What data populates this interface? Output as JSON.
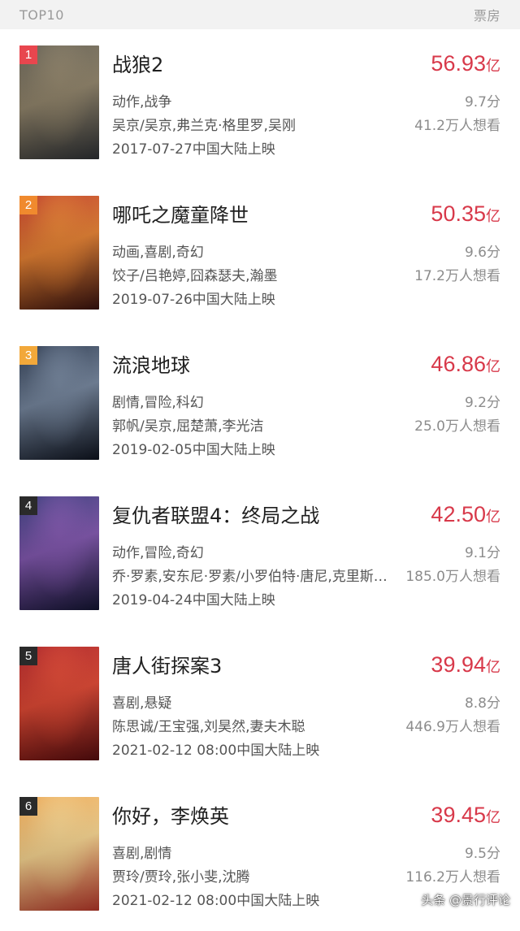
{
  "header": {
    "left": "TOP10",
    "right": "票房"
  },
  "movies": [
    {
      "rank": "1",
      "rank_color": "#e8464e",
      "title": "战狼2",
      "box_num": "56.93",
      "box_unit": "亿",
      "genre": "动作,战争",
      "score": "9.7分",
      "cast": "吴京/吴京,弗兰克·格里罗,吴刚",
      "want": "41.2万人想看",
      "release": "2017-07-27中国大陆上映",
      "poster_colors": [
        "#5a5548",
        "#8a7d63",
        "#2f3236"
      ]
    },
    {
      "rank": "2",
      "rank_color": "#f08a2e",
      "title": "哪吒之魔童降世",
      "box_num": "50.35",
      "box_unit": "亿",
      "genre": "动画,喜剧,奇幻",
      "score": "9.6分",
      "cast": "饺子/吕艳婷,囧森瑟夫,瀚墨",
      "want": "17.2万人想看",
      "release": "2019-07-26中国大陆上映",
      "poster_colors": [
        "#b8321e",
        "#e07a2a",
        "#3a1210"
      ]
    },
    {
      "rank": "3",
      "rank_color": "#f2a83a",
      "title": "流浪地球",
      "box_num": "46.86",
      "box_unit": "亿",
      "genre": "剧情,冒险,科幻",
      "score": "9.2分",
      "cast": "郭帆/吴京,屈楚萧,李光洁",
      "want": "25.0万人想看",
      "release": "2019-02-05中国大陆上映",
      "poster_colors": [
        "#1d2a40",
        "#6d7e96",
        "#0f1420"
      ]
    },
    {
      "rank": "4",
      "rank_color": "#2a2a2a",
      "title": "复仇者联盟4：终局之战",
      "box_num": "42.50",
      "box_unit": "亿",
      "genre": "动作,冒险,奇幻",
      "score": "9.1分",
      "cast": "乔·罗素,安东尼·罗素/小罗伯特·唐尼,克里斯…",
      "want": "185.0万人想看",
      "release": "2019-04-24中国大陆上映",
      "poster_colors": [
        "#2a2f6e",
        "#7a4fa8",
        "#131533"
      ]
    },
    {
      "rank": "5",
      "rank_color": "#2a2a2a",
      "title": "唐人街探案3",
      "box_num": "39.94",
      "box_unit": "亿",
      "genre": "喜剧,悬疑",
      "score": "8.8分",
      "cast": "陈思诚/王宝强,刘昊然,妻夫木聪",
      "want": "446.9万人想看",
      "release": "2021-02-12 08:00中国大陆上映",
      "poster_colors": [
        "#a3171b",
        "#d9402b",
        "#5a0d0f"
      ]
    },
    {
      "rank": "6",
      "rank_color": "#2a2a2a",
      "title": "你好，李焕英",
      "box_num": "39.45",
      "box_unit": "亿",
      "genre": "喜剧,剧情",
      "score": "9.5分",
      "cast": "贾玲/贾玲,张小斐,沈腾",
      "want": "116.2万人想看",
      "release": "2021-02-12 08:00中国大陆上映",
      "poster_colors": [
        "#e8a04a",
        "#f3d08a",
        "#c0392b"
      ]
    }
  ],
  "watermark": "头条 @景行评论"
}
